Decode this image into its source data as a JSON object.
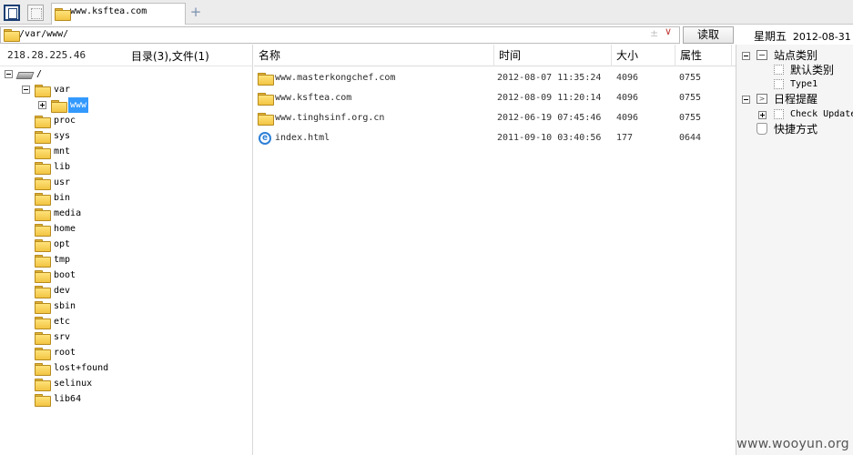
{
  "tabbar": {
    "active_tab": "www.ksftea.com",
    "add_tab": "+"
  },
  "pathbar": {
    "path": "/var/www/",
    "plusminus": "±",
    "dropdown": "∨",
    "read_button": "读取"
  },
  "date_header": {
    "weekday": "星期五",
    "date": "2012-08-31"
  },
  "tree": {
    "server_ip": "218.28.225.46",
    "summary": "目录(3),文件(1)",
    "root": "/",
    "var": "var",
    "selected": "www",
    "folders": [
      "proc",
      "sys",
      "mnt",
      "lib",
      "usr",
      "bin",
      "media",
      "home",
      "opt",
      "tmp",
      "boot",
      "dev",
      "sbin",
      "etc",
      "srv",
      "root",
      "lost+found",
      "selinux",
      "lib64"
    ]
  },
  "file_list": {
    "columns": [
      "名称",
      "时间",
      "大小",
      "属性"
    ],
    "rows": [
      {
        "name": "www.masterkongchef.com",
        "time": "2012-08-07 11:35:24",
        "size": "4096",
        "attr": "0755",
        "type": "folder"
      },
      {
        "name": "www.ksftea.com",
        "time": "2012-08-09 11:20:14",
        "size": "4096",
        "attr": "0755",
        "type": "folder"
      },
      {
        "name": "www.tinghsinf.org.cn",
        "time": "2012-06-19 07:45:46",
        "size": "4096",
        "attr": "0755",
        "type": "folder"
      },
      {
        "name": "index.html",
        "time": "2011-09-10 03:40:56",
        "size": "177",
        "attr": "0644",
        "type": "html"
      }
    ]
  },
  "right_panel": {
    "site_category": "站点类别",
    "default_category": "默认类别",
    "type1": "Type1",
    "schedule": "日程提醒",
    "check_update": "Check Update",
    "shortcuts": "快捷方式"
  },
  "watermark": "www.wooyun.org"
}
